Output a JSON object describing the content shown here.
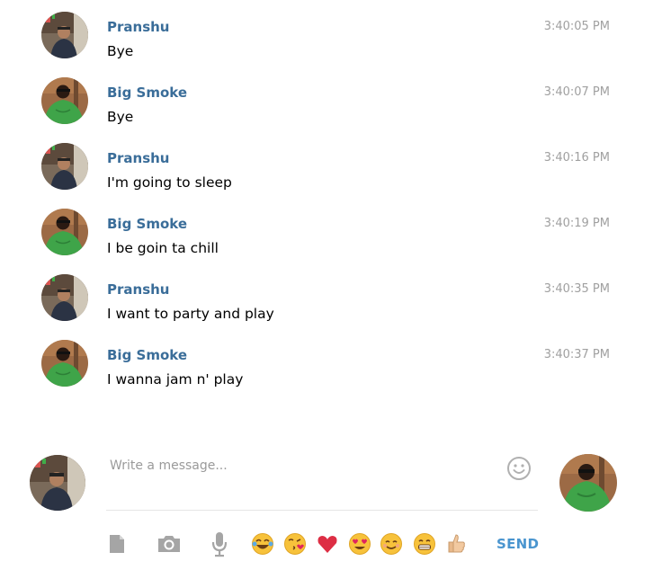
{
  "messages": [
    {
      "sender": "Pranshu",
      "avatar": "pranshu-avatar",
      "text": "Bye",
      "time": "3:40:05 PM"
    },
    {
      "sender": "Big Smoke",
      "avatar": "big-smoke-avatar",
      "text": "Bye",
      "time": "3:40:07 PM"
    },
    {
      "sender": "Pranshu",
      "avatar": "pranshu-avatar",
      "text": "I'm going to sleep",
      "time": "3:40:16 PM"
    },
    {
      "sender": "Big Smoke",
      "avatar": "big-smoke-avatar",
      "text": "I be goin ta chill",
      "time": "3:40:19 PM"
    },
    {
      "sender": "Pranshu",
      "avatar": "pranshu-avatar",
      "text": "I want to party and play",
      "time": "3:40:35 PM"
    },
    {
      "sender": "Big Smoke",
      "avatar": "big-smoke-avatar",
      "text": "I wanna jam n' play",
      "time": "3:40:37 PM"
    }
  ],
  "composer": {
    "placeholder": "Write a message...",
    "send_label": "SEND",
    "tools": [
      "document-icon",
      "camera-icon",
      "microphone-icon"
    ],
    "emojis": [
      {
        "name": "tears-of-joy-emoji",
        "glyph": "😂"
      },
      {
        "name": "kissing-heart-emoji",
        "glyph": "😘"
      },
      {
        "name": "red-heart-emoji",
        "glyph": "❤"
      },
      {
        "name": "heart-eyes-emoji",
        "glyph": "😍"
      },
      {
        "name": "smiling-emoji",
        "glyph": "😊"
      },
      {
        "name": "grinning-emoji",
        "glyph": "😁"
      },
      {
        "name": "thumbs-up-emoji",
        "glyph": "👍"
      }
    ]
  },
  "colors": {
    "sender_name": "#3a6d99",
    "timestamp": "#a0a0a0",
    "send": "#4a95cf",
    "icon_gray": "#a5a5a5"
  }
}
